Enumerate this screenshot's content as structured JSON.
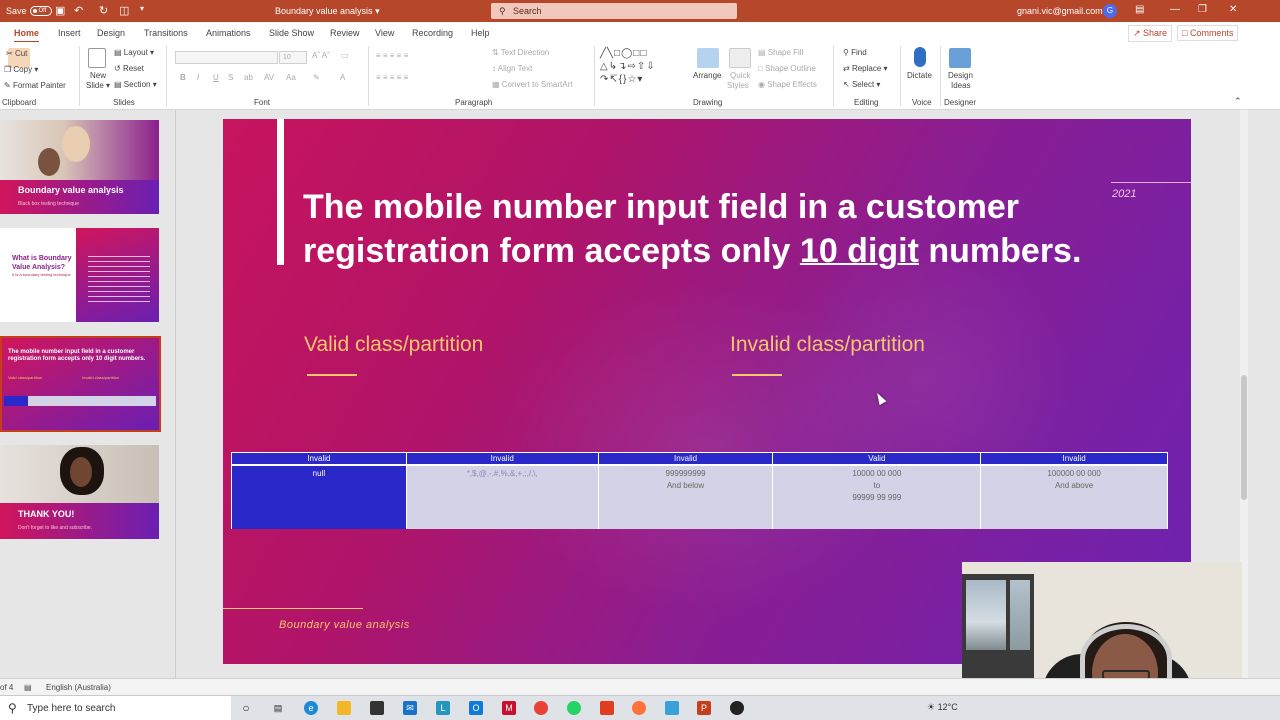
{
  "titlebar": {
    "autosave_label": "Save",
    "toggle_state": "Off",
    "doc_title": "Boundary value analysis",
    "search_placeholder": "Search",
    "account": "gnani.vic@gmail.com",
    "avatar_initial": "G"
  },
  "tabs": [
    "Home",
    "Insert",
    "Design",
    "Transitions",
    "Animations",
    "Slide Show",
    "Review",
    "View",
    "Recording",
    "Help"
  ],
  "active_tab": "Home",
  "share_label": "Share",
  "comments_label": "Comments",
  "ribbon": {
    "clipboard": {
      "cut": "Cut",
      "copy": "Copy",
      "format_painter": "Format Painter",
      "label": "Clipboard"
    },
    "slides": {
      "new_slide": "New",
      "new_slide2": "Slide",
      "layout": "Layout",
      "reset": "Reset",
      "section": "Section",
      "label": "Slides"
    },
    "font": {
      "size": "10",
      "label": "Font"
    },
    "paragraph": {
      "text_direction": "Text Direction",
      "align_text": "Align Text",
      "smartart": "Convert to SmartArt",
      "label": "Paragraph"
    },
    "drawing": {
      "arrange": "Arrange",
      "quick_styles": "Quick",
      "quick_styles2": "Styles",
      "shape_fill": "Shape Fill",
      "shape_outline": "Shape Outline",
      "shape_effects": "Shape Effects",
      "label": "Drawing"
    },
    "editing": {
      "find": "Find",
      "replace": "Replace",
      "select": "Select",
      "label": "Editing"
    },
    "voice": {
      "dictate": "Dictate",
      "label": "Voice"
    },
    "designer": {
      "design_ideas": "Design",
      "design_ideas2": "Ideas",
      "label": "Designer"
    }
  },
  "thumbnails": {
    "t1_title": "Boundary value analysis",
    "t1_sub": "Black box testing technique",
    "t2_title": "What is Boundary Value Analysis?",
    "t2_sub": "It is a boundary testing technique",
    "t3_title": "The mobile number input field in a customer registration form accepts only 10 digit numbers.",
    "t3_l1": "Valid class/partition",
    "t3_l2": "Invalid class/partition",
    "t4_title": "THANK YOU!",
    "t4_sub": "Don't forget to like and subscribe."
  },
  "slide": {
    "title_part1": "The mobile number input field in a customer registration form accepts only ",
    "title_underlined": "10 digit",
    "title_part2": " numbers.",
    "year": "2021",
    "valid_heading": "Valid class/partition",
    "invalid_heading": "Invalid class/partition",
    "footer": "Boundary value analysis"
  },
  "table": {
    "headers": [
      "Invalid",
      "Invalid",
      "Invalid",
      "Valid",
      "Invalid"
    ],
    "cells": [
      [
        "null"
      ],
      [
        "*,$,@,-,#,%,&,+,;,/,\\,"
      ],
      [
        "999999999",
        "And below"
      ],
      [
        "10000 00 000",
        "to",
        "99999 99 999"
      ],
      [
        "100000 00 000",
        "And above"
      ]
    ]
  },
  "statusbar": {
    "slide_of": "of 4",
    "language": "English (Australia)"
  },
  "taskbar": {
    "search_placeholder": "Type here to search",
    "weather": "12°C"
  }
}
